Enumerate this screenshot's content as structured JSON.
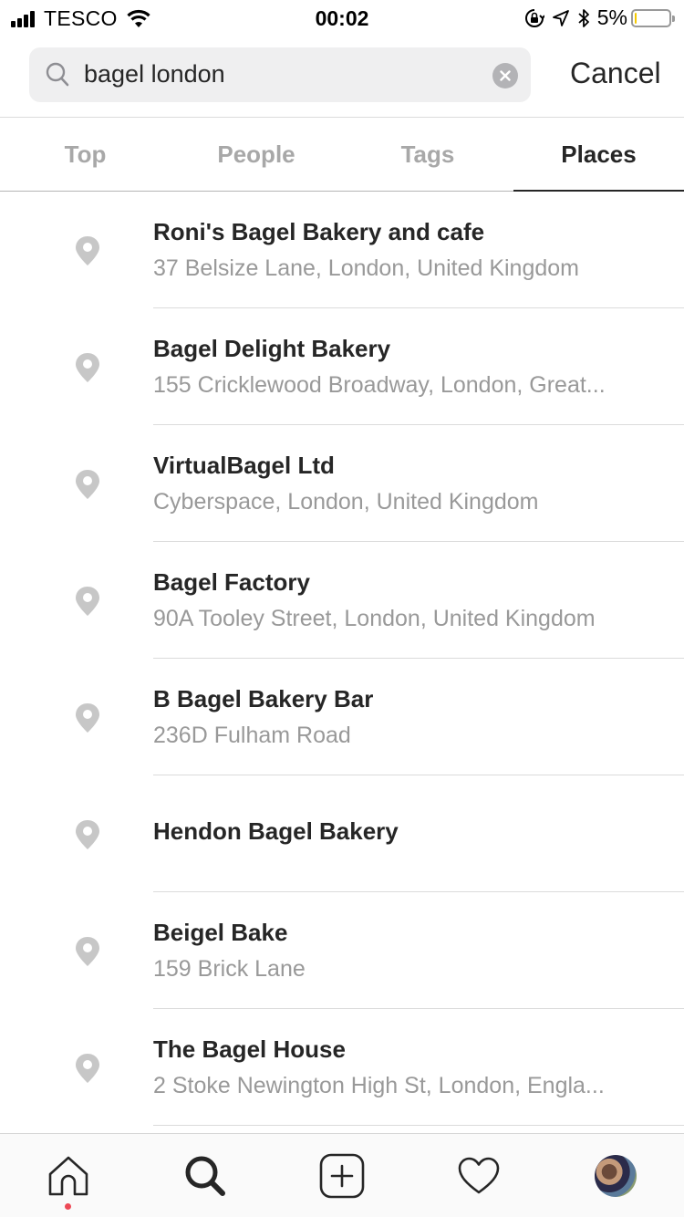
{
  "status_bar": {
    "carrier": "TESCO",
    "time": "00:02",
    "battery_percent": "5%",
    "battery_level": 0.05
  },
  "search": {
    "query": "bagel london",
    "cancel_label": "Cancel"
  },
  "tabs": [
    {
      "label": "Top",
      "active": false
    },
    {
      "label": "People",
      "active": false
    },
    {
      "label": "Tags",
      "active": false
    },
    {
      "label": "Places",
      "active": true
    }
  ],
  "places": [
    {
      "name": "Roni's Bagel Bakery and cafe",
      "address": "37 Belsize Lane, London, United Kingdom"
    },
    {
      "name": "Bagel Delight Bakery",
      "address": "155 Cricklewood Broadway, London, Great..."
    },
    {
      "name": "VirtualBagel Ltd",
      "address": "Cyberspace, London, United Kingdom"
    },
    {
      "name": "Bagel Factory",
      "address": "90A Tooley Street, London, United Kingdom"
    },
    {
      "name": "B Bagel Bakery Bar",
      "address": "236D Fulham Road"
    },
    {
      "name": "Hendon Bagel Bakery",
      "address": ""
    },
    {
      "name": "Beigel Bake",
      "address": "159 Brick Lane"
    },
    {
      "name": "The Bagel House",
      "address": "2 Stoke Newington High St, London, Engla..."
    }
  ],
  "bottom_nav": [
    {
      "icon": "home-icon",
      "has_notification": true
    },
    {
      "icon": "search-icon",
      "active": true
    },
    {
      "icon": "add-post-icon"
    },
    {
      "icon": "heart-icon"
    },
    {
      "icon": "profile-avatar"
    }
  ],
  "colors": {
    "accent_text": "#262626",
    "muted_text": "#999999",
    "notification_dot": "#ed4956",
    "battery_low": "#f5c900"
  }
}
